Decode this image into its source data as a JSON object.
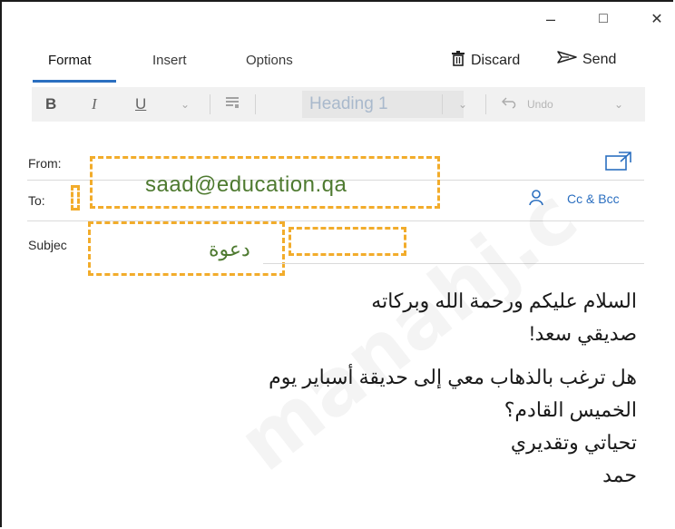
{
  "window": {
    "minimize": "–",
    "maximize": "□",
    "close": "✕"
  },
  "tabs": {
    "format": "Format",
    "insert": "Insert",
    "options": "Options"
  },
  "actions": {
    "discard": "Discard",
    "send": "Send"
  },
  "toolbar": {
    "bold": "B",
    "italic": "I",
    "underline": "U",
    "style": "Heading 1",
    "undo": "Undo"
  },
  "fields": {
    "from_label": "From:",
    "from_value": "saad@education.qa",
    "to_label": "To:",
    "cc_bcc": "Cc & Bcc",
    "subject_label": "Subjec",
    "subject_value": "دعوة"
  },
  "message": {
    "lines": [
      "السلام عليكم ورحمة الله وبركاته",
      "صديقي سعد!",
      "هل ترغب بالذهاب معي إلى حديقة أسباير يوم",
      "الخميس القادم؟",
      "تحياتي وتقديري",
      "حمد"
    ]
  },
  "watermark": "manahj.c",
  "colors": {
    "accent": "#2b6fc0",
    "highlight": "#f2ac2b",
    "field_text": "#4e7a30"
  }
}
